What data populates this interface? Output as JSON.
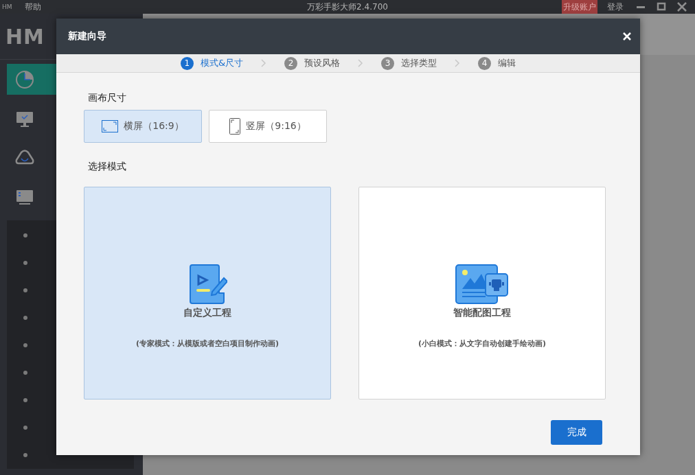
{
  "app": {
    "logo_small": "HM",
    "menu": [
      "帮助"
    ],
    "title": "万彩手影大师2.4.700",
    "upgrade_button": "升级账户",
    "login_link": "登录"
  },
  "sidebar": {
    "logo": "HM",
    "items": [
      {
        "kind": "recent",
        "selected": true
      },
      {
        "kind": "monitor",
        "selected": false
      },
      {
        "kind": "cloud",
        "selected": false
      },
      {
        "kind": "online",
        "selected": false
      }
    ]
  },
  "dialog": {
    "title": "新建向导",
    "steps": [
      {
        "number": "1",
        "label": "模式&尺寸",
        "selected": true
      },
      {
        "number": "2",
        "label": "预设风格",
        "selected": false
      },
      {
        "number": "3",
        "label": "选择类型",
        "selected": false
      },
      {
        "number": "4",
        "label": "编辑",
        "selected": false
      }
    ],
    "canvas_size": {
      "label": "画布尺寸",
      "options": [
        {
          "label": "横屏（16:9）",
          "kind": "landscape",
          "selected": true
        },
        {
          "label": "竖屏（9:16）",
          "kind": "portrait",
          "selected": false
        }
      ]
    },
    "mode": {
      "label": "选择模式",
      "options": [
        {
          "title": "自定义工程",
          "description": "(专家模式：从模版或者空白项目制作动画)",
          "kind": "custom",
          "selected": true
        },
        {
          "title": "智能配图工程",
          "description": "(小白模式：从文字自动创建手绘动画)",
          "kind": "smart",
          "selected": false
        }
      ]
    },
    "finish_button": "完成"
  }
}
